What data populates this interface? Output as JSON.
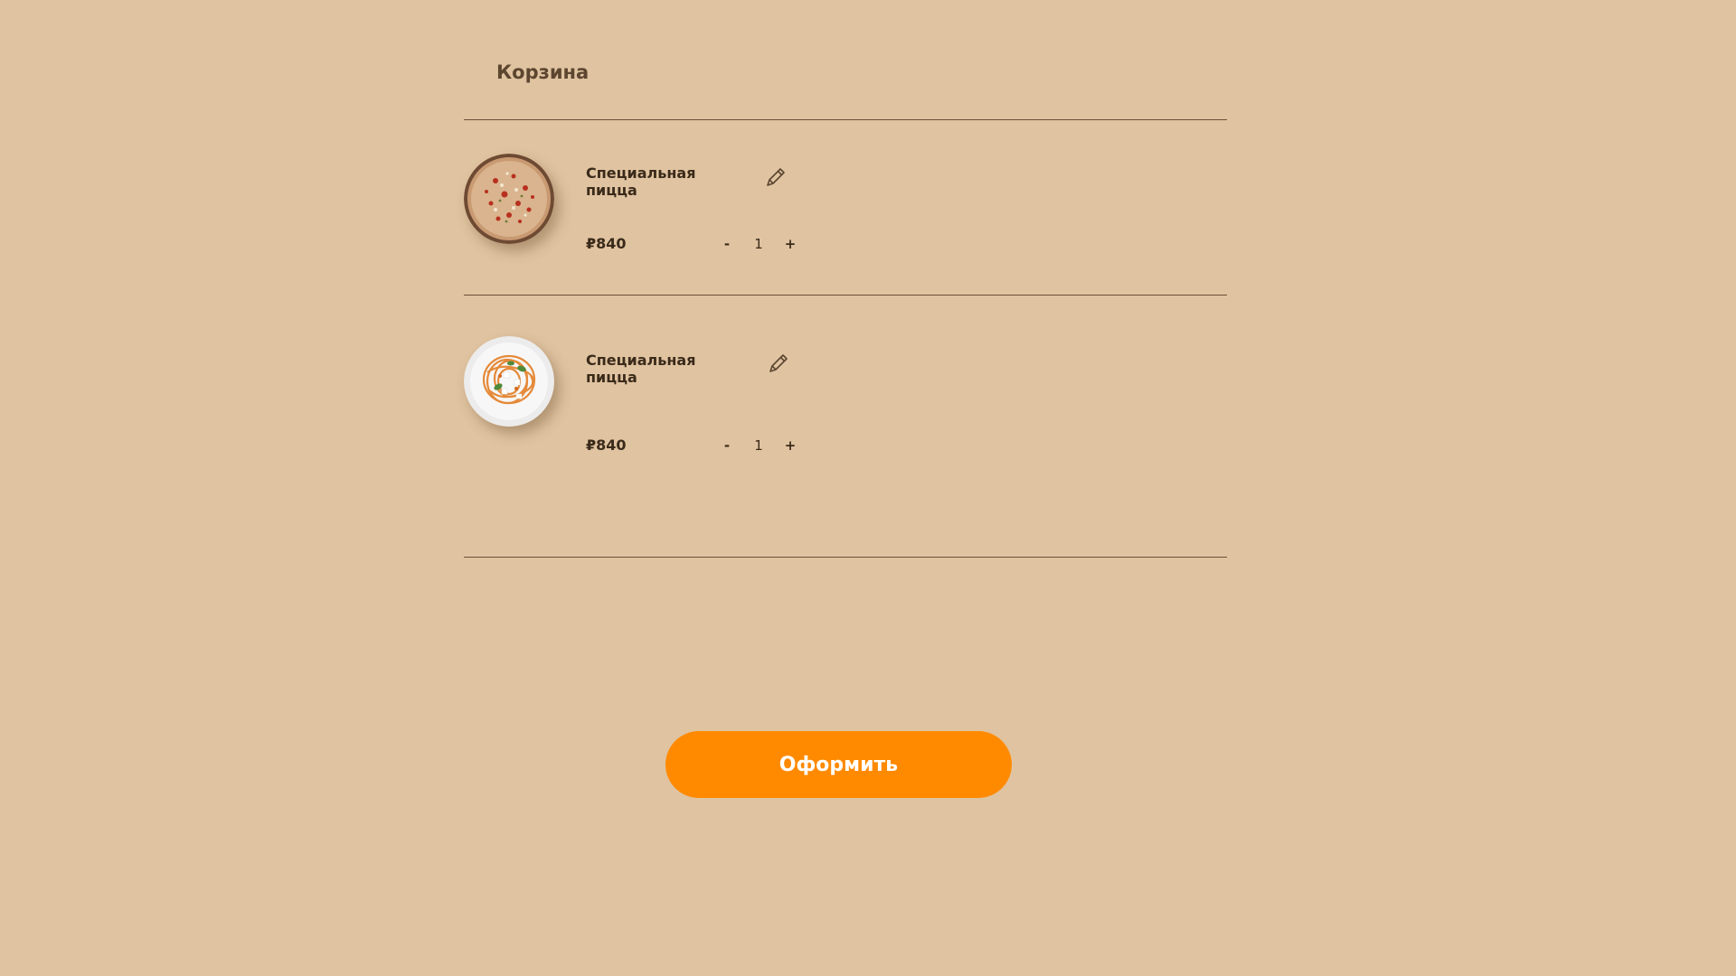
{
  "cart": {
    "title": "Корзина",
    "items": [
      {
        "name": "Специальная пицца",
        "price": "₽840",
        "quantity": "1",
        "minus_label": "-",
        "plus_label": "+",
        "image_icon": "pizza-image"
      },
      {
        "name": "Специальная пицца",
        "price": "₽840",
        "quantity": "1",
        "minus_label": "-",
        "plus_label": "+",
        "image_icon": "pasta-image"
      }
    ],
    "checkout_label": "Оформить"
  },
  "colors": {
    "background": "#e0c3a0",
    "accent": "#ff8a00",
    "text": "#3a2a1a"
  }
}
